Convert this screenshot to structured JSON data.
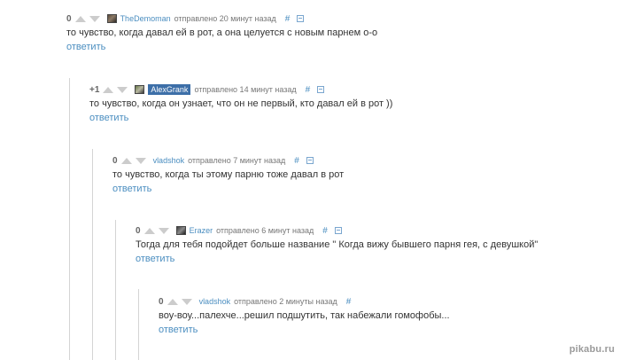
{
  "comments": [
    {
      "rating": "0",
      "user": "TheDemoman",
      "time": "отправлено 20 минут назад",
      "hash": "#",
      "text": "то чувство, когда давал ей в рот, а она целуется с новым парнем о-о",
      "reply": "ответить"
    },
    {
      "rating": "+1",
      "user": "AlexGrank",
      "time": "отправлено 14 минут назад",
      "hash": "#",
      "text": "то чувство, когда он узнает, что он не первый, кто давал ей в рот ))",
      "reply": "ответить"
    },
    {
      "rating": "0",
      "user": "vladshok",
      "time": "отправлено 7 минут назад",
      "hash": "#",
      "text": "то чувство, когда ты этому парню тоже давал в рот",
      "reply": "ответить"
    },
    {
      "rating": "0",
      "user": "Erazer",
      "time": "отправлено 6 минут назад",
      "hash": "#",
      "text": "Тогда для тебя подойдет больше название \" Когда вижу бывшего парня гея, с девушкой\"",
      "reply": "ответить"
    },
    {
      "rating": "0",
      "user": "vladshok",
      "time": "отправлено 2 минуты назад",
      "hash": "#",
      "text": "воу-воу...палехче...решил подшутить, так набежали гомофобы...",
      "reply": "ответить"
    }
  ],
  "watermark": "pikabu.ru"
}
